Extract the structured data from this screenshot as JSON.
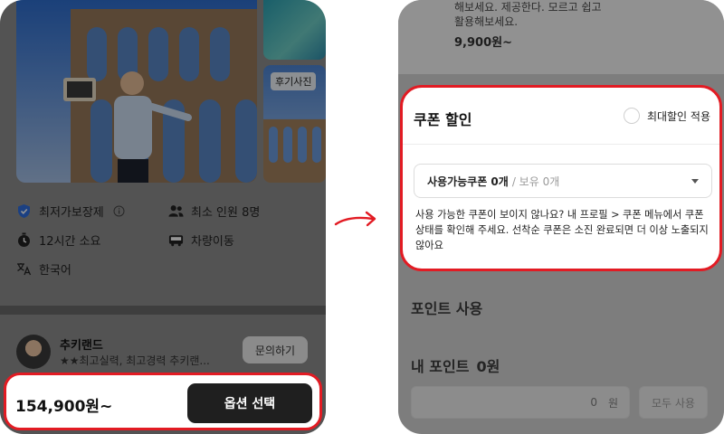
{
  "left": {
    "review_tag": "후기사진",
    "info": [
      {
        "icon": "shield-check-icon",
        "label": "최저가보장제",
        "has_info": true
      },
      {
        "icon": "people-icon",
        "label": "최소 인원 8명"
      },
      {
        "icon": "stopwatch-icon",
        "label": "12시간 소요"
      },
      {
        "icon": "car-icon",
        "label": "차량이동"
      },
      {
        "icon": "translate-icon",
        "label": "한국어"
      }
    ],
    "guide": {
      "name": "추키랜드",
      "desc": "★★최고실력, 최고경력 추키랜..."
    },
    "ask_label": "문의하기",
    "price": "154,900원~",
    "option_label": "옵션 선택"
  },
  "right": {
    "top_desc_line1": "해보세요. 제공한다. 모르고 쉽고",
    "top_desc_line2": "활용해보세요.",
    "top_price": "9,900원~",
    "coupon": {
      "title": "쿠폰 할인",
      "max_discount_label": "최대할인 적용",
      "select_main": "사용가능쿠폰 0개",
      "select_sub": "/ 보유 0개",
      "note": "사용 가능한 쿠폰이 보이지 않나요? 내 프로필 > 쿠폰 메뉴에서 쿠폰 상태를 확인해 주세요. 선착순 쿠폰은 소진 완료되면 더 이상 노출되지 않아요"
    },
    "points_title": "포인트 사용",
    "my_points_label": "내 포인트",
    "my_points_value": "0원",
    "points_input_value": "0",
    "points_input_unit": "원",
    "use_all_label": "모두 사용"
  },
  "colors": {
    "highlight": "#e21b23",
    "button_dark": "#1f1f1f",
    "shield_blue": "#2f6fe0"
  }
}
